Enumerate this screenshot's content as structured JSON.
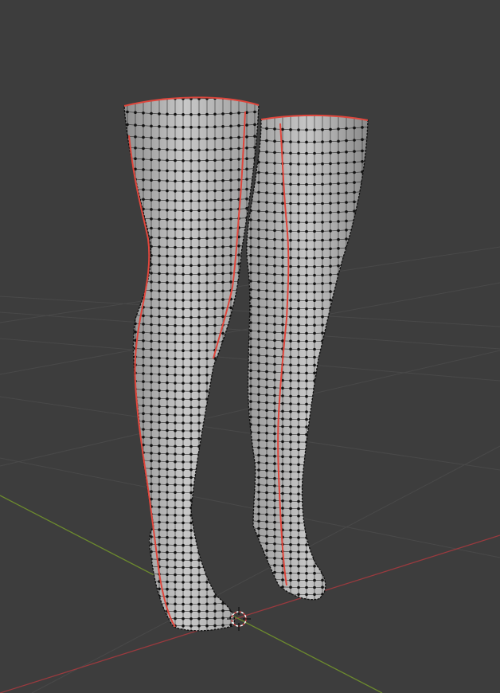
{
  "viewport": {
    "mode": "edit-mode",
    "mesh": "legs-stockings",
    "selection": "all-vertices",
    "seams": "marked-red"
  },
  "colors": {
    "background": "#3d3d3d",
    "grid_line": "#494949",
    "axis_x": "#9a3a3e",
    "axis_y": "#6c8a2e",
    "mesh_surface": "#b8b8b8",
    "mesh_shadow": "#8e8e8e",
    "wire": "#2a2a2a",
    "vertex": "#111111",
    "seam": "#e0463c",
    "cursor": "#d04040"
  },
  "icons": {
    "cursor": "3d-cursor-icon"
  }
}
